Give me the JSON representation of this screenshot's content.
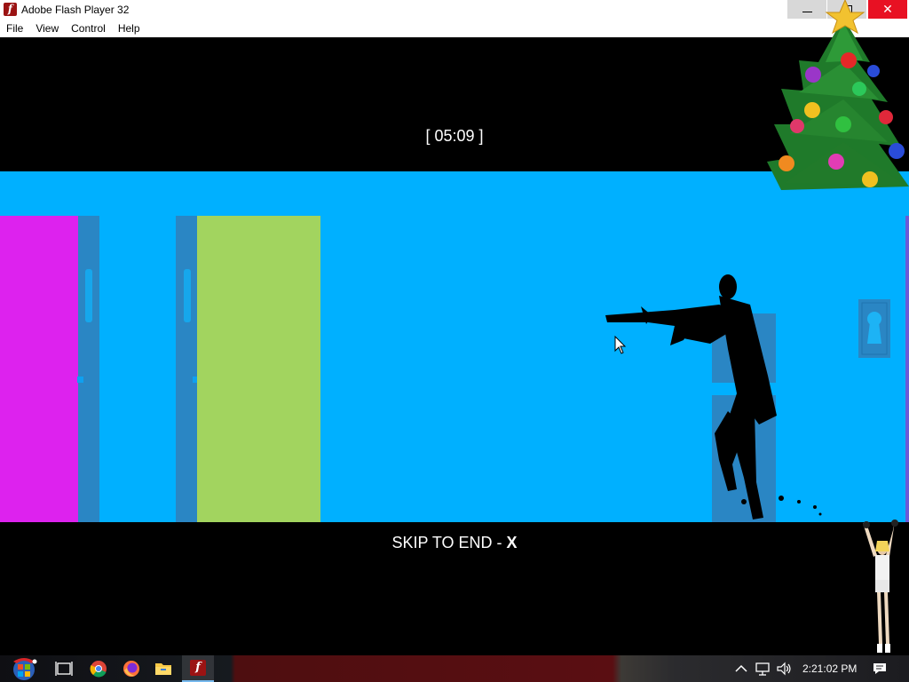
{
  "window": {
    "title": "Adobe Flash Player 32",
    "icon": "flash-player-icon",
    "close_glyph": "✕"
  },
  "menubar": {
    "items": [
      "File",
      "View",
      "Control",
      "Help"
    ]
  },
  "game": {
    "timer": "[ 05:09 ]",
    "skip_text": "SKIP TO END - ",
    "skip_key": "X",
    "colors": {
      "stage_background": "#000000",
      "room_wall": "#00b0ff",
      "magenta_door": "#dd22ee",
      "green_door": "#a2d45f",
      "door_frame": "#2a86c4"
    }
  },
  "overlays": {
    "decorations": [
      "christmas-tree-icon",
      "dancing-figure-icon"
    ]
  },
  "taskbar": {
    "clock": "2:21:02 PM",
    "pinned_icons": [
      "start-button-icon",
      "task-view-icon",
      "chrome-icon",
      "firefox-icon",
      "file-explorer-icon",
      "flash-player-icon"
    ],
    "tray_icons": [
      "chevron-up-icon",
      "network-icon",
      "volume-icon",
      "notification-icon"
    ]
  }
}
